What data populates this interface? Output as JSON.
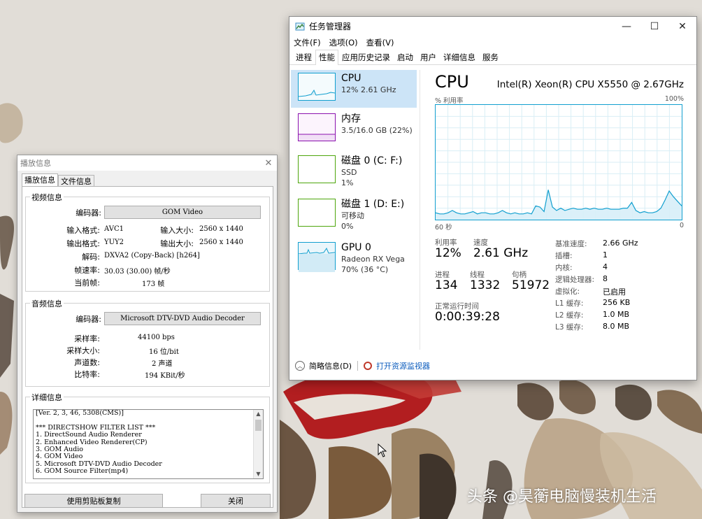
{
  "task_manager": {
    "title": "任务管理器",
    "menu": [
      "文件(F)",
      "选项(O)",
      "查看(V)"
    ],
    "tabs": [
      "进程",
      "性能",
      "应用历史记录",
      "启动",
      "用户",
      "详细信息",
      "服务"
    ],
    "active_tab": "性能",
    "sidebar": [
      {
        "title": "CPU",
        "sub1": "12% 2.61 GHz",
        "sub2": ""
      },
      {
        "title": "内存",
        "sub1": "3.5/16.0 GB (22%)",
        "sub2": ""
      },
      {
        "title": "磁盘 0 (C: F:)",
        "sub1": "SSD",
        "sub2": "1%"
      },
      {
        "title": "磁盘 1 (D: E:)",
        "sub1": "可移动",
        "sub2": "0%"
      },
      {
        "title": "GPU 0",
        "sub1": "Radeon RX Vega",
        "sub2": "70% (36 °C)"
      }
    ],
    "cpu": {
      "heading": "CPU",
      "model": "Intel(R) Xeon(R) CPU X5550 @ 2.67GHz",
      "graph_label_left": "% 利用率",
      "graph_label_right": "100%",
      "axis_left": "60 秒",
      "axis_right": "0",
      "usage_series": [
        6,
        5,
        5,
        6,
        8,
        6,
        5,
        5,
        6,
        7,
        5,
        6,
        6,
        5,
        5,
        6,
        8,
        6,
        5,
        6,
        5,
        5,
        6,
        5,
        12,
        11,
        7,
        26,
        11,
        8,
        10,
        8,
        9,
        10,
        9,
        9,
        10,
        9,
        10,
        9,
        9,
        10,
        9,
        9,
        9,
        10,
        10,
        15,
        8,
        6,
        7,
        6,
        6,
        7,
        10,
        17,
        25,
        20,
        16,
        12
      ],
      "stats": {
        "utilization_label": "利用率",
        "utilization": "12%",
        "speed_label": "速度",
        "speed": "2.61 GHz",
        "processes_label": "进程",
        "processes": "134",
        "threads_label": "线程",
        "threads": "1332",
        "handles_label": "句柄",
        "handles": "51972",
        "uptime_label": "正常运行时间",
        "uptime": "0:00:39:28"
      },
      "info": [
        {
          "label": "基准速度:",
          "value": "2.66 GHz"
        },
        {
          "label": "插槽:",
          "value": "1"
        },
        {
          "label": "内核:",
          "value": "4"
        },
        {
          "label": "逻辑处理器:",
          "value": "8"
        },
        {
          "label": "虚拟化:",
          "value": "已启用"
        },
        {
          "label": "L1 缓存:",
          "value": "256 KB"
        },
        {
          "label": "L2 缓存:",
          "value": "1.0 MB"
        },
        {
          "label": "L3 缓存:",
          "value": "8.0 MB"
        }
      ]
    },
    "footer": {
      "summary": "简略信息(D)",
      "resmon": "打开资源监视器"
    }
  },
  "playback_info": {
    "title": "播放信息",
    "tabs": [
      "播放信息",
      "文件信息"
    ],
    "video": {
      "group": "视频信息",
      "codec_label": "编码器:",
      "codec": "GOM Video",
      "input_format_label": "输入格式:",
      "input_format": "AVC1",
      "input_size_label": "输入大小:",
      "input_size": "2560 x 1440",
      "output_format_label": "输出格式:",
      "output_format": "YUY2",
      "output_size_label": "输出大小:",
      "output_size": "2560 x 1440",
      "decode_label": "解码:",
      "decode": "DXVA2 (Copy-Back) [h264]",
      "framerate_label": "帧速率:",
      "framerate": "30.03 (30.00) 帧/秒",
      "current_frame_label": "当前帧:",
      "current_frame": "173  帧"
    },
    "audio": {
      "group": "音频信息",
      "codec_label": "编码器:",
      "codec": "Microsoft DTV-DVD Audio Decoder",
      "sample_rate_label": "采样率:",
      "sample_rate": "44100 bps",
      "sample_size_label": "采样大小:",
      "sample_size": "16 位/bit",
      "channels_label": "声道数:",
      "channels": "2 声道",
      "bitrate_label": "比特率:",
      "bitrate": "194 KBit/秒"
    },
    "details": {
      "group": "详细信息",
      "lines": [
        "[Ver. 2, 3, 46, 5308(CMS)]",
        "",
        "*** DIRECTSHOW FILTER LIST ***",
        "1. DirectSound Audio Renderer",
        "2. Enhanced Video Renderer(CP)",
        "3. GOM Audio",
        "4. GOM Video",
        "5. Microsoft DTV-DVD Audio Decoder",
        "6. GOM Source Filter(mp4)"
      ]
    },
    "copy_button": "使用剪贴板复制",
    "close_button": "关闭"
  },
  "watermark": "头条 @昊蘅电脑慢装机生活"
}
